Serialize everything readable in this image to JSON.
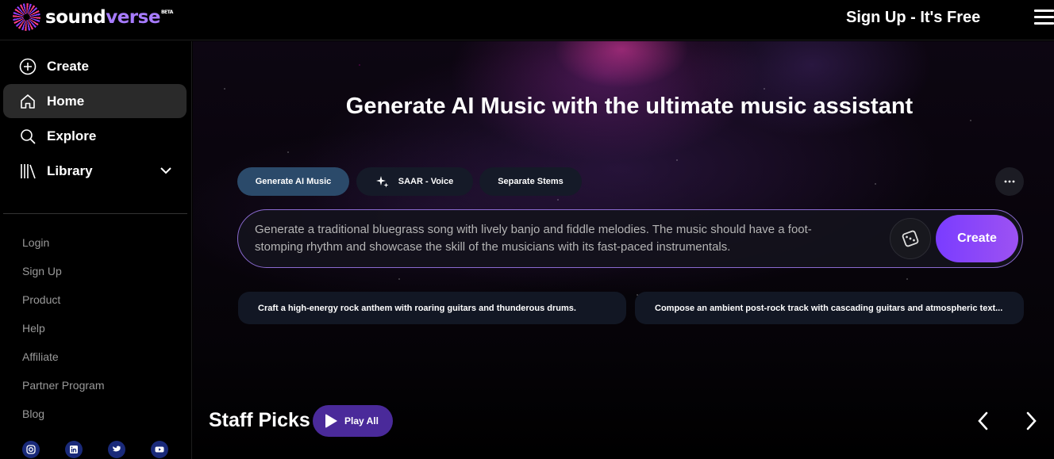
{
  "brand": {
    "name_part1": "sound",
    "name_part2": "verse",
    "badge": "BETA",
    "accent": "#a77bff"
  },
  "header": {
    "signup_label": "Sign Up - It's Free",
    "menu_icon": "hamburger-menu-icon"
  },
  "sidebar": {
    "nav": [
      {
        "label": "Create",
        "icon": "plus-circle-icon",
        "active": false
      },
      {
        "label": "Home",
        "icon": "home-icon",
        "active": true
      },
      {
        "label": "Explore",
        "icon": "search-icon",
        "active": false
      },
      {
        "label": "Library",
        "icon": "library-icon",
        "active": false,
        "expandable": true
      }
    ],
    "links": [
      "Login",
      "Sign Up",
      "Product",
      "Help",
      "Affiliate",
      "Partner Program",
      "Blog"
    ],
    "social": [
      "instagram-icon",
      "linkedin-icon",
      "twitter-icon",
      "youtube-icon"
    ]
  },
  "hero": {
    "headline": "Generate AI Music with the ultimate music assistant",
    "tabs": [
      {
        "label": "Generate AI Music",
        "active": true
      },
      {
        "label": "SAAR - Voice",
        "active": false,
        "icon": "sparkle-icon"
      },
      {
        "label": "Separate Stems",
        "active": false
      }
    ],
    "prompt": "Generate a traditional bluegrass song with lively banjo and fiddle melodies. The music should have a foot-stomping rhythm and showcase the skill of the musicians with its fast-paced instrumentals.",
    "create_label": "Create",
    "suggestions": [
      "Craft a high-energy rock anthem with roaring guitars and thunderous drums.",
      "Compose an ambient post-rock track with cascading guitars and atmospheric text..."
    ]
  },
  "staff_picks": {
    "title": "Staff Picks",
    "play_all_label": "Play All"
  }
}
